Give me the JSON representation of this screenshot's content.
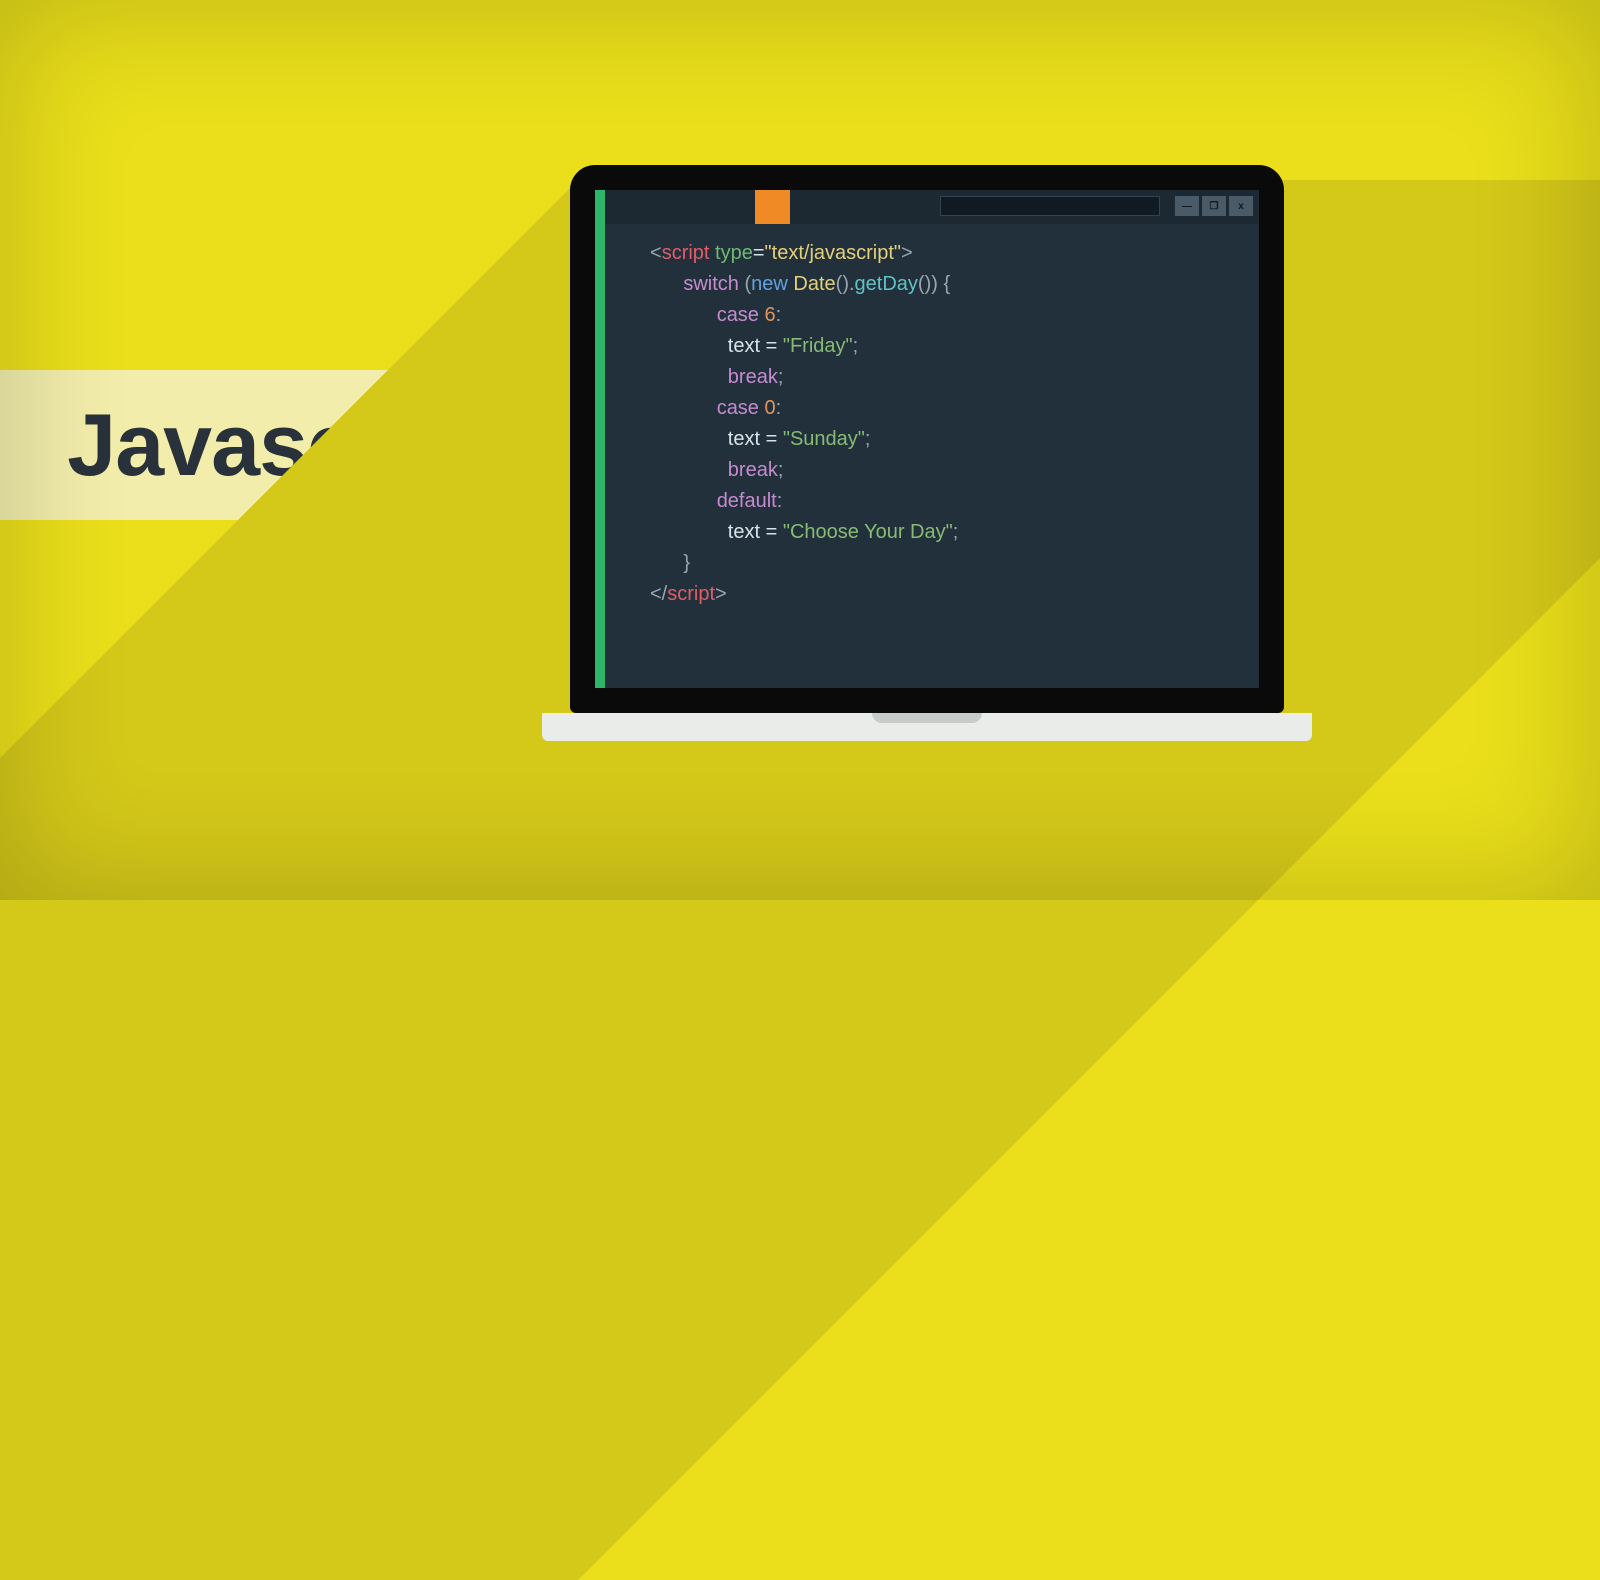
{
  "title": "Javascript",
  "window": {
    "minimize": "—",
    "maximize": "❐",
    "close": "x"
  },
  "code": {
    "l1_open": "<",
    "l1_tag": "script",
    "l1_sp": " ",
    "l1_attr": "type",
    "l1_eq": "=",
    "l1_q1": "\"",
    "l1_val": "text/javascript",
    "l1_q2": "\"",
    "l1_close": ">",
    "l2_kw": "switch",
    "l2_p1": " (",
    "l2_new": "new",
    "l2_sp1": " ",
    "l2_type": "Date",
    "l2_p2": "().",
    "l2_fn": "getDay",
    "l2_p3": "()) {",
    "l3_case": "case",
    "l3_sp": " ",
    "l3_num": "6",
    "l3_colon": ":",
    "l4_ident": "text",
    "l4_eq": " = ",
    "l4_q": "\"",
    "l4_str": "Friday",
    "l4_q2": "\"",
    "l4_semi": ";",
    "l5_break": "break",
    "l5_semi": ";",
    "l6_case": "case",
    "l6_sp": " ",
    "l6_num": "0",
    "l6_colon": ":",
    "l7_ident": "text",
    "l7_eq": " = ",
    "l7_q": "\"",
    "l7_str": "Sunday",
    "l7_q2": "\"",
    "l7_semi": ";",
    "l8_break": "break",
    "l8_semi": ";",
    "l9_default": "default",
    "l9_colon": ":",
    "l10_ident": "text",
    "l10_eq": " = ",
    "l10_q": "\"",
    "l10_str": "Choose Your Day",
    "l10_q2": "\"",
    "l10_semi": ";",
    "l11_brace": "}",
    "l12_open": "</",
    "l12_tag": "script",
    "l12_close": ">"
  }
}
